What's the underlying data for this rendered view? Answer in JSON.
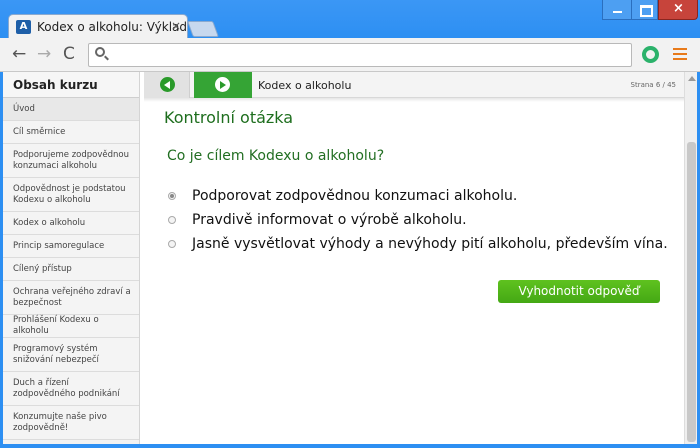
{
  "browser": {
    "tab_title": "Kodex o alkoholu: Výklad",
    "tab_close": "×",
    "favicon_letter": "A",
    "nav_back": "←",
    "nav_forward": "→",
    "nav_reload": "C",
    "window_close": "×",
    "address_value": ""
  },
  "sidebar": {
    "title": "Obsah kurzu",
    "items": [
      {
        "label": "Úvod",
        "lines": 1
      },
      {
        "label": "Cíl směrnice",
        "lines": 1
      },
      {
        "label": "Podporujeme zodpovědnou konzumaci alkoholu",
        "lines": 2
      },
      {
        "label": "Odpovědnost je podstatou Kodexu o alkoholu",
        "lines": 2
      },
      {
        "label": "Kodex o alkoholu",
        "lines": 1
      },
      {
        "label": "Princip samoregulace",
        "lines": 1
      },
      {
        "label": "Cílený přístup",
        "lines": 1
      },
      {
        "label": "Ochrana veřejného zdraví a bezpečnost",
        "lines": 2
      },
      {
        "label": "Prohlášení Kodexu o alkoholu",
        "lines": 1
      },
      {
        "label": "Programový systém snižování nebezpečí",
        "lines": 2
      },
      {
        "label": "Duch a řízení zodpovědného podnikání",
        "lines": 2
      },
      {
        "label": "Konzumujte naše pivo zodpovědně!",
        "lines": 2
      }
    ]
  },
  "content": {
    "heading": "Kodex o alkoholu",
    "page_counter": "Strana 6 / 45",
    "section_title": "Kontrolní otázka",
    "question": "Co je cílem Kodexu o alkoholu?",
    "options": [
      {
        "label": "Podporovat zodpovědnou konzumaci alkoholu.",
        "selected": true
      },
      {
        "label": "Pravdivě informovat o výrobě alkoholu.",
        "selected": false
      },
      {
        "label": "Jasně vysvětlovat výhody a nevýhody pití alkoholu, především vína.",
        "selected": false
      }
    ],
    "submit_label": "Vyhodnotit odpověď"
  },
  "colors": {
    "accent_green": "#44a814",
    "title_green": "#1e6e1e",
    "browser_blue": "#2d8ff2"
  }
}
